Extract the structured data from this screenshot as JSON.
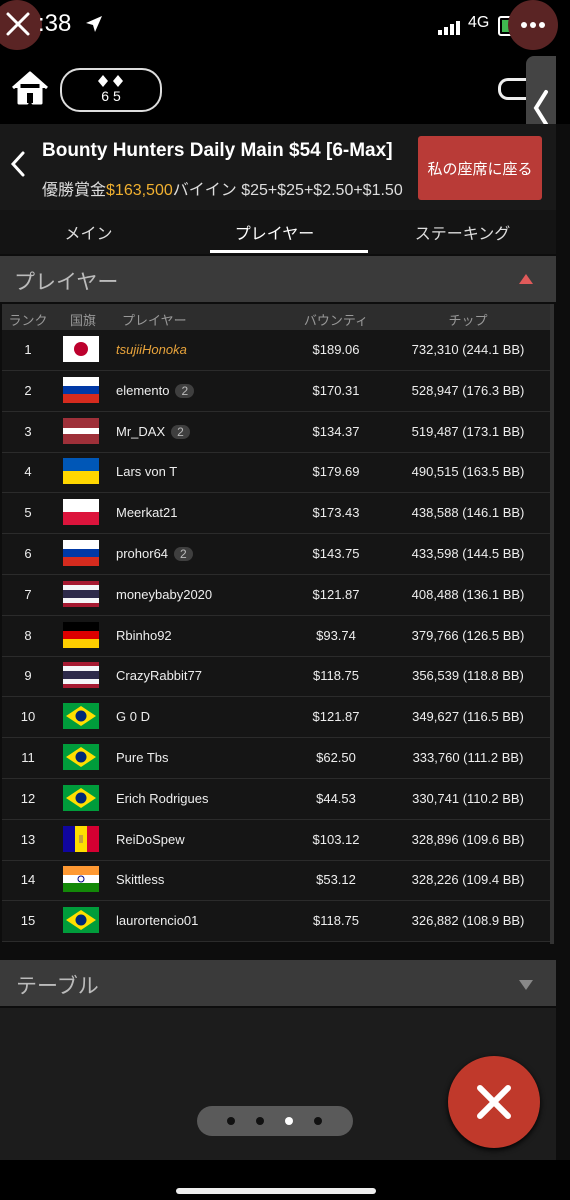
{
  "status_bar": {
    "time": ":38",
    "network": "4G"
  },
  "top_bar": {
    "blinds_icon": "spades-icon",
    "blinds_value": "6 5"
  },
  "tournament": {
    "title": "Bounty Hunters Daily Main $54 [6-Max]",
    "prize_label": "優勝賞金",
    "prize_value": "$163,500",
    "buyin_label": "バイイン",
    "buyin_value": "$25+$25+$2.50+$1.50",
    "seat_button": "私の座席に座る"
  },
  "tabs": [
    "メイン",
    "プレイヤー",
    "ステーキング"
  ],
  "active_tab": 1,
  "players_section": {
    "title": "プレイヤー",
    "columns": [
      "ランク",
      "国旗",
      "プレイヤー",
      "バウンティ",
      "チップ"
    ],
    "rows": [
      {
        "rank": "1",
        "flag": "jp",
        "name": "tsujiiHonoka",
        "badge": "",
        "bounty": "$189.06",
        "chips": "732,310 (244.1 BB)"
      },
      {
        "rank": "2",
        "flag": "ru",
        "name": "elemento",
        "badge": "2",
        "bounty": "$170.31",
        "chips": "528,947 (176.3 BB)"
      },
      {
        "rank": "3",
        "flag": "lv",
        "name": "Mr_DAX",
        "badge": "2",
        "bounty": "$134.37",
        "chips": "519,487 (173.1 BB)"
      },
      {
        "rank": "4",
        "flag": "ua",
        "name": "Lars von T",
        "badge": "",
        "bounty": "$179.69",
        "chips": "490,515 (163.5 BB)"
      },
      {
        "rank": "5",
        "flag": "pl",
        "name": "Meerkat21",
        "badge": "",
        "bounty": "$173.43",
        "chips": "438,588 (146.1 BB)"
      },
      {
        "rank": "6",
        "flag": "ru",
        "name": "prohor64",
        "badge": "2",
        "bounty": "$143.75",
        "chips": "433,598 (144.5 BB)"
      },
      {
        "rank": "7",
        "flag": "th",
        "name": "moneybaby2020",
        "badge": "",
        "bounty": "$121.87",
        "chips": "408,488 (136.1 BB)"
      },
      {
        "rank": "8",
        "flag": "de",
        "name": "Rbinho92",
        "badge": "",
        "bounty": "$93.74",
        "chips": "379,766 (126.5 BB)"
      },
      {
        "rank": "9",
        "flag": "th",
        "name": "CrazyRabbit77",
        "badge": "",
        "bounty": "$118.75",
        "chips": "356,539 (118.8 BB)"
      },
      {
        "rank": "10",
        "flag": "br",
        "name": "G 0 D",
        "badge": "",
        "bounty": "$121.87",
        "chips": "349,627 (116.5 BB)"
      },
      {
        "rank": "11",
        "flag": "br",
        "name": "Pure Tbs",
        "badge": "",
        "bounty": "$62.50",
        "chips": "333,760 (111.2 BB)"
      },
      {
        "rank": "12",
        "flag": "br",
        "name": "Erich Rodrigues",
        "badge": "",
        "bounty": "$44.53",
        "chips": "330,741 (110.2 BB)"
      },
      {
        "rank": "13",
        "flag": "ad",
        "name": "ReiDoSpew",
        "badge": "",
        "bounty": "$103.12",
        "chips": "328,896 (109.6 BB)"
      },
      {
        "rank": "14",
        "flag": "in",
        "name": "Skittless",
        "badge": "",
        "bounty": "$53.12",
        "chips": "328,226 (109.4 BB)"
      },
      {
        "rank": "15",
        "flag": "br",
        "name": "laurortencio01",
        "badge": "",
        "bounty": "$118.75",
        "chips": "326,882 (108.9 BB)"
      }
    ]
  },
  "tables_section": {
    "title": "テーブル"
  },
  "pager": {
    "count": 4,
    "active": 2
  },
  "colors": {
    "accent_red": "#c0392b",
    "gold": "#f0b030",
    "hero_name": "#e8a33b"
  }
}
